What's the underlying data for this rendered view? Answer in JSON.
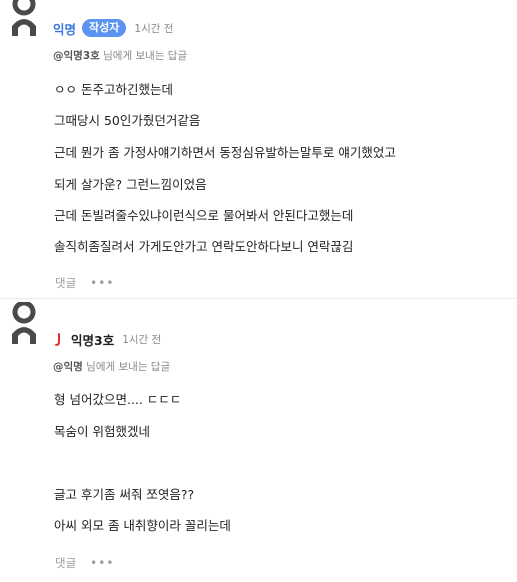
{
  "comments": [
    {
      "author": "익명",
      "badge": "작성자",
      "time": "1시간 전",
      "reply_to_user": "@익명3호",
      "reply_suffix": " 님에게 보내는 답글",
      "lines": [
        "ㅇㅇ 돈주고하긴했는데",
        "그때당시 50인가줬던거같음",
        "근데 뭔가 좀 가정사얘기하면서 동정심유발하는말투로 얘기했었고",
        "되게 살가운? 그런느낌이었음",
        "근데 돈빌려줄수있냐이런식으로 물어봐서 안된다고했는데",
        "솔직히좀질려서 가게도안가고 연락도안하다보니 연락끊김"
      ],
      "reply_label": "댓글",
      "more_label": "•••"
    },
    {
      "author": "익명3호",
      "time": "1시간 전",
      "reply_to_user": "@익명",
      "reply_suffix": " 님에게 보내는 답글",
      "lines": [
        "형 넘어갔으면.... ㄷㄷㄷ",
        "목숨이 위험했겠네",
        "",
        "글고 후기좀 써줘 쪼엿음??",
        "아씨 외모 좀 내취향이라 꼴리는데"
      ],
      "reply_label": "댓글",
      "more_label": "•••"
    }
  ],
  "colors": {
    "author_blue": "#3a78e0",
    "badge_bg": "#5a93f0",
    "muted": "#888888",
    "mark_red": "#e03030",
    "avatar_gray": "#4a4a4a"
  }
}
